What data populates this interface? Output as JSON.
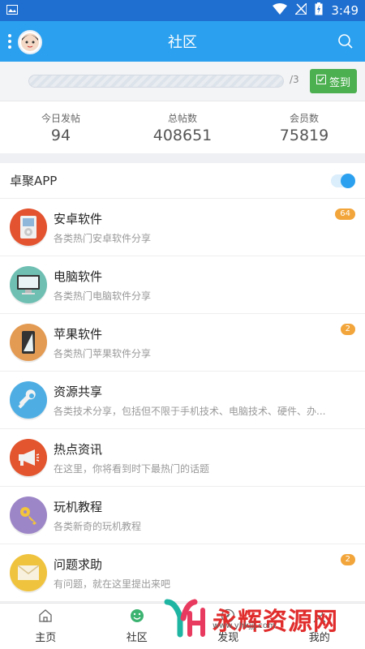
{
  "status_bar": {
    "time": "3:49"
  },
  "header": {
    "title": "社区"
  },
  "signin": {
    "progress_text": "/3",
    "button_label": "签到"
  },
  "stats": [
    {
      "label": "今日发帖",
      "value": "94"
    },
    {
      "label": "总帖数",
      "value": "408651"
    },
    {
      "label": "会员数",
      "value": "75819"
    }
  ],
  "section": {
    "name": "卓聚APP",
    "toggle_on": true
  },
  "forums": [
    {
      "title": "安卓软件",
      "desc": "各类热门安卓软件分享",
      "badge": "64",
      "color": "#e3532f",
      "icon": "ipod-icon"
    },
    {
      "title": "电脑软件",
      "desc": "各类热门电脑软件分享",
      "badge": "",
      "color": "#6fbfb3",
      "icon": "monitor-icon"
    },
    {
      "title": "苹果软件",
      "desc": "各类热门苹果软件分享",
      "badge": "2",
      "color": "#e39a52",
      "icon": "phone-icon"
    },
    {
      "title": "资源共享",
      "desc": "各类技术分享，包括但不限于手机技术、电脑技术、硬件、办...",
      "badge": "",
      "color": "#4eaee3",
      "icon": "wrench-icon"
    },
    {
      "title": "热点资讯",
      "desc": "在这里，你将看到时下最热门的话题",
      "badge": "",
      "color": "#e2552e",
      "icon": "megaphone-icon"
    },
    {
      "title": "玩机教程",
      "desc": "各类新奇的玩机教程",
      "badge": "",
      "color": "#9d86c7",
      "icon": "key-icon"
    },
    {
      "title": "问题求助",
      "desc": "有问题，就在这里提出来吧",
      "badge": "2",
      "color": "#f0c33e",
      "icon": "envelope-icon"
    }
  ],
  "tabs": [
    {
      "label": "主页"
    },
    {
      "label": "社区"
    },
    {
      "label": "发现"
    },
    {
      "label": "我的"
    }
  ],
  "watermark": {
    "text": "永辉资源网",
    "url": "www.yhkjjj.com"
  }
}
